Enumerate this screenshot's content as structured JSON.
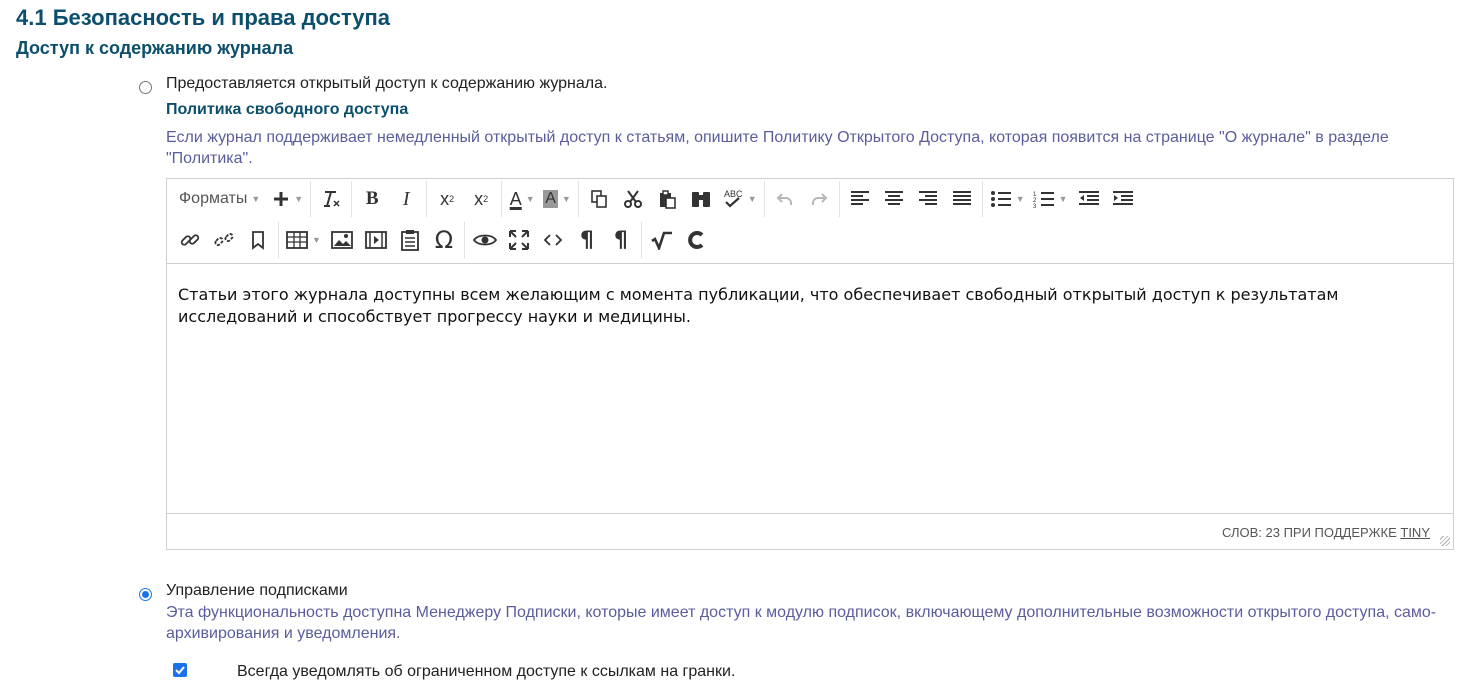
{
  "section": {
    "title": "4.1 Безопасность и права доступа",
    "subtitle": "Доступ к содержанию журнала"
  },
  "open_access": {
    "label": "Предоставляется открытый доступ к содержанию журнала.",
    "selected": false,
    "policy_title": "Политика свободного доступа",
    "policy_desc": "Если журнал поддерживает немедленный открытый доступ к статьям, опишите Политику Открытого Доступа, которая появится на странице \"О журнале\" в разделе \"Политика\"."
  },
  "editor": {
    "formats_label": "Форматы",
    "content": "Статьи этого журнала доступны всем желающим с момента публикации, что обеспечивает свободный открытый доступ к результатам исследований и способствует прогрессу науки и медицины.",
    "status_prefix": "СЛОВ: 23 ПРИ ПОДДЕРЖКЕ ",
    "status_link": "TINY",
    "toolbar_icons": [
      "insert-icon",
      "clear-formatting-icon",
      "bold-icon",
      "italic-icon",
      "subscript-icon",
      "superscript-icon",
      "text-color-icon",
      "background-color-icon",
      "copy-icon",
      "cut-icon",
      "paste-icon",
      "find-replace-icon",
      "spellcheck-icon",
      "undo-icon",
      "redo-icon",
      "align-left-icon",
      "align-center-icon",
      "align-right-icon",
      "align-justify-icon",
      "bullet-list-icon",
      "numbered-list-icon",
      "outdent-icon",
      "indent-icon",
      "link-icon",
      "unlink-icon",
      "bookmark-icon",
      "table-icon",
      "image-icon",
      "media-icon",
      "paste-text-icon",
      "special-char-icon",
      "preview-icon",
      "fullscreen-icon",
      "code-icon",
      "show-blocks-icon",
      "paragraph-icon",
      "formula-icon",
      "citation-icon"
    ]
  },
  "subscriptions": {
    "label": "Управление подписками",
    "selected": true,
    "desc": "Эта функциональность доступна Менеджеру Подписки, которые имеет доступ к модулю подписок, включающему дополнительные возможности открытого доступа, само-архивирования и уведомления."
  },
  "notify": {
    "label": "Всегда уведомлять об ограниченном доступе к ссылкам на гранки.",
    "checked": true
  },
  "colors": {
    "heading": "#0b4f6c",
    "description": "#5a5d9c",
    "accent": "#1a73e8"
  }
}
